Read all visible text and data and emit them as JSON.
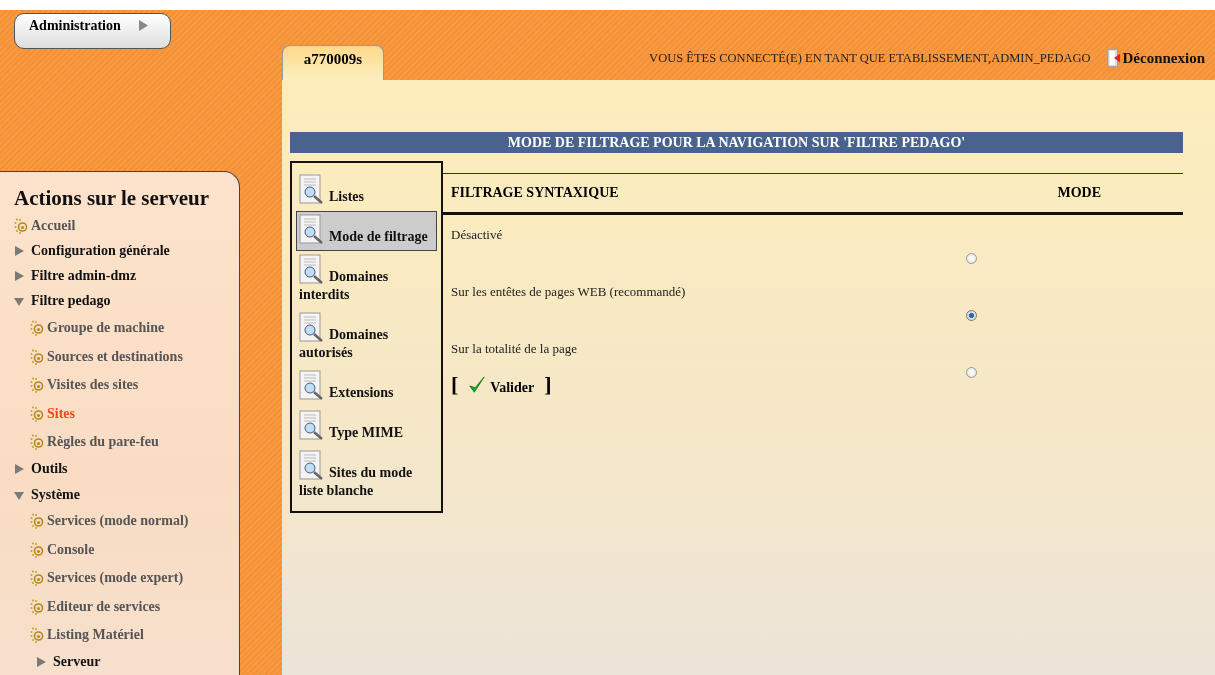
{
  "admin_button": {
    "label": "Administration"
  },
  "tab": {
    "label": "a770009s",
    "selected": true
  },
  "session": {
    "text": "VOUS ÊTES CONNECTÉ(E) EN TANT QUE ETABLISSEMENT,ADMIN_PEDAGO",
    "logout": "Déconnexion"
  },
  "sidebar": {
    "title": "Actions sur le serveur",
    "items": [
      {
        "label": "Accueil",
        "kind": "leaf",
        "selected": false
      },
      {
        "label": "Configuration générale",
        "kind": "folder",
        "expanded": false
      },
      {
        "label": "Filtre admin-dmz",
        "kind": "folder",
        "expanded": false
      },
      {
        "label": "Filtre pedago",
        "kind": "folder",
        "expanded": true,
        "children": [
          {
            "label": "Groupe de machine",
            "kind": "leaf",
            "selected": false
          },
          {
            "label": "Sources et destinations",
            "kind": "leaf",
            "selected": false
          },
          {
            "label": "Visites des sites",
            "kind": "leaf",
            "selected": false
          },
          {
            "label": "Sites",
            "kind": "leaf",
            "selected": true
          },
          {
            "label": "Règles du pare-feu",
            "kind": "leaf",
            "selected": false
          }
        ]
      },
      {
        "label": "Outils",
        "kind": "folder",
        "expanded": false
      },
      {
        "label": "Système",
        "kind": "folder",
        "expanded": true,
        "children": [
          {
            "label": "Services (mode normal)",
            "kind": "leaf",
            "selected": false
          },
          {
            "label": "Console",
            "kind": "leaf",
            "selected": false
          },
          {
            "label": "Services (mode expert)",
            "kind": "leaf",
            "selected": false
          },
          {
            "label": "Editeur de services",
            "kind": "leaf",
            "selected": false
          },
          {
            "label": "Listing Matériel",
            "kind": "leaf",
            "selected": false
          },
          {
            "label": "Serveur",
            "kind": "folder",
            "expanded": false
          }
        ]
      }
    ]
  },
  "page_title": "MODE DE FILTRAGE POUR LA NAVIGATION SUR 'FILTRE PEDAGO'",
  "submenu": [
    {
      "label": "Listes",
      "selected": false
    },
    {
      "label": "Mode de filtrage",
      "selected": true
    },
    {
      "label": "Domaines interdits",
      "selected": false
    },
    {
      "label": "Domaines autorisés",
      "selected": false
    },
    {
      "label": "Extensions",
      "selected": false
    },
    {
      "label": "Type MIME",
      "selected": false
    },
    {
      "label": "Sites du mode liste blanche",
      "selected": false
    }
  ],
  "table": {
    "columns": [
      "FILTRAGE SYNTAXIQUE",
      "MODE"
    ],
    "rows": [
      {
        "label": "Désactivé",
        "selected": false
      },
      {
        "label": "Sur les entêtes de pages WEB (recommandé)",
        "selected": true
      },
      {
        "label": "Sur la totalité de la page",
        "selected": false
      }
    ]
  },
  "submit": {
    "open": "[",
    "label": "Valider",
    "close": "]"
  }
}
